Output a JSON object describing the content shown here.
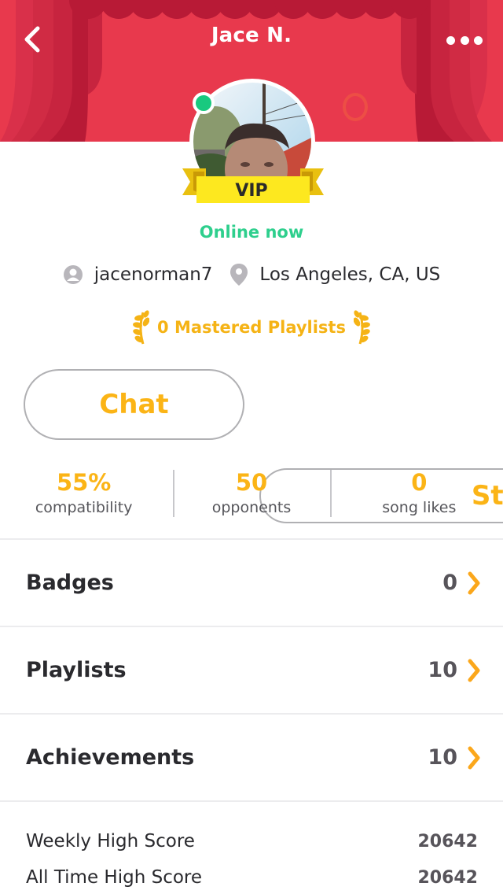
{
  "header": {
    "title": "Jace N.",
    "back_icon": "chevron-left-icon",
    "more_icon": "more-horizontal-icon",
    "background_color": "#e8394d"
  },
  "profile": {
    "avatar_alt": "Profile photo of Jace N.",
    "online_indicator_color": "#19c97f",
    "vip_label": "VIP",
    "status_text": "Online now",
    "username": "jacenorman7",
    "location": "Los Angeles, CA, US",
    "mastered_playlists": "0 Mastered Playlists"
  },
  "actions": {
    "chat_label": "Chat",
    "stats_label": "Stats",
    "accent_color": "#fbb416"
  },
  "stats": [
    {
      "value": "55%",
      "label": "compatibility"
    },
    {
      "value": "50",
      "label": "opponents"
    },
    {
      "value": "0",
      "label": "song likes"
    }
  ],
  "sections": [
    {
      "label": "Badges",
      "count": "0"
    },
    {
      "label": "Playlists",
      "count": "10"
    },
    {
      "label": "Achievements",
      "count": "10"
    }
  ],
  "scores": [
    {
      "label": "Weekly High Score",
      "value": "20642"
    },
    {
      "label": "All Time High Score",
      "value": "20642"
    }
  ]
}
